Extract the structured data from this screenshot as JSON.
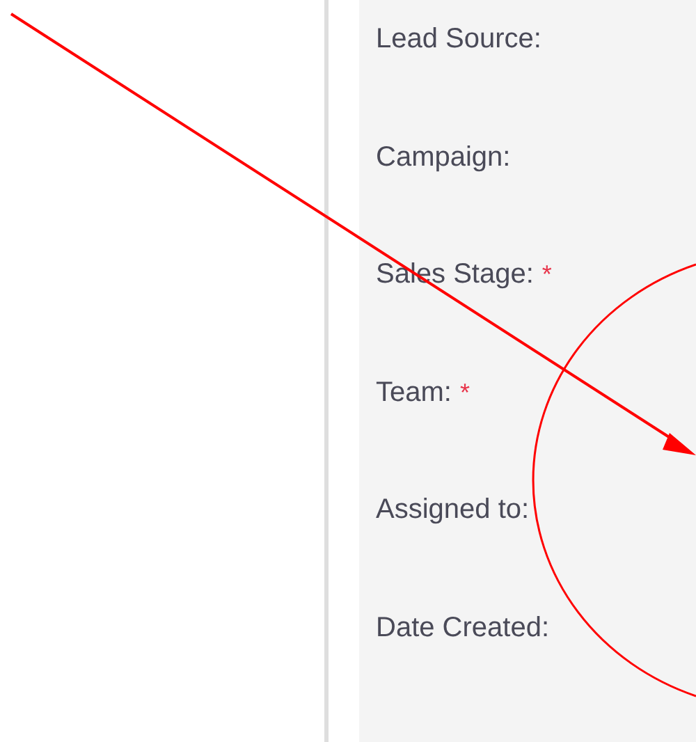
{
  "fields": [
    {
      "label": "Lead Source:"
    },
    {
      "label": "Campaign:"
    },
    {
      "label": "Sales Stage:",
      "required_mark": "*"
    },
    {
      "label": "Team:",
      "required_mark": "*"
    },
    {
      "label": "Assigned to:"
    },
    {
      "label": "Date Created:"
    }
  ]
}
